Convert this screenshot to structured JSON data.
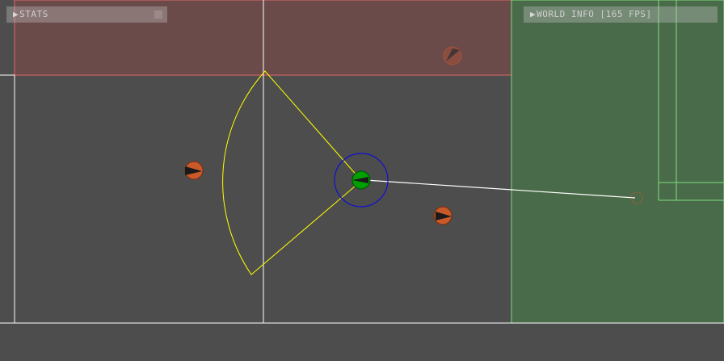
{
  "panels": {
    "stats": {
      "arrow": "▶",
      "label": "STATS"
    },
    "world_info": {
      "arrow": "▶",
      "label": "WORLD INFO [165 FPS]"
    }
  },
  "colors": {
    "background": "#4d4d4d",
    "red_zone": "#6b4a4a",
    "red_zone_border": "#e06666",
    "green_zone": "#4a6b4a",
    "green_zone_border": "#7fdc7f",
    "grid_line": "#ffffff",
    "vision_cone": "#ffff00",
    "player": "#00a000",
    "player_range": "#1010d0",
    "enemy": "#c85a2a",
    "target_line": "#ffffff"
  },
  "icons": {
    "panel_toggle": "triangle-right-icon"
  }
}
